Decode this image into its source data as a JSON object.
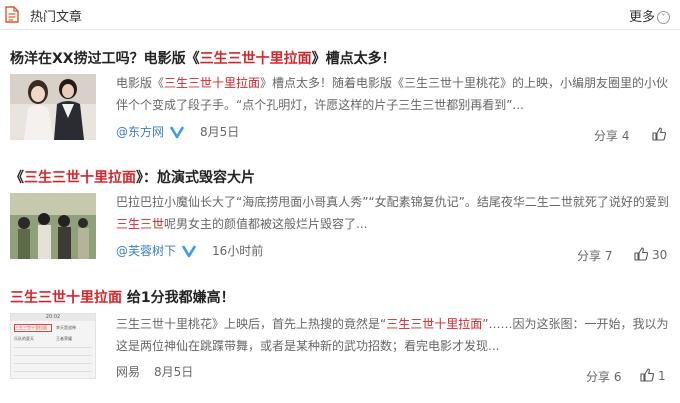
{
  "header": {
    "title": "热门文章",
    "more_label": "更多"
  },
  "articles": [
    {
      "title_parts": [
        "杨洋在XX捞过工吗？电影版《",
        "三生三世十里拉面",
        "》槽点太多！"
      ],
      "snippet_parts": [
        "电影版《",
        "三生三世十里拉面",
        "》槽点太多！随着电影版《三生三世十里桃花》的上映，小编朋友圈里的小伙伴个个变成了段子手。“点个孔明灯，许愿这样的片子三生三世都别再看到”..."
      ],
      "source_prefix": "@",
      "source": "东方网",
      "verified": true,
      "date": "8月5日",
      "share": "分享 4",
      "likes": ""
    },
    {
      "title_parts": [
        "《",
        "三生三世十里拉面",
        "》：尬演式毁容大片"
      ],
      "snippet_parts": [
        "巴拉巴拉小魔仙长大了“海底捞甩面小哥真人秀”“女配素锦复仇记”。结尾夜华二生二世就死了说好的爱到",
        "三生三世",
        "呢男女主的颜值都被这般烂片毁容了..."
      ],
      "source_prefix": "@",
      "source": "芙蓉树下",
      "verified": true,
      "date": "16小时前",
      "share": "分享 7",
      "likes": "30"
    },
    {
      "title_parts": [
        "",
        "三生三世十里拉面",
        " 给1分我都嫌高！"
      ],
      "snippet_parts": [
        "三生三世十里桃花》上映后，首先上热搜的竟然是“",
        "三生三世十里拉面",
        "”……因为这张图：一开始，我以为这是两位神仙在跳蹀带舞，或者是某种新的武功招数；看完电影才发现..."
      ],
      "source_prefix": "",
      "source": "网易",
      "verified": false,
      "date": "8月5日",
      "share": "分享 6",
      "likes": "1"
    }
  ],
  "thumb3_text": [
    "20:02",
    "三生三世十里拉面",
    "李天是战神",
    "乐队的夏天",
    "王者荣耀"
  ],
  "colors": {
    "accent_red": "#d4252b",
    "link_blue": "#3d7ec0",
    "text_gray": "#666666"
  },
  "icons": {
    "header": "document-icon",
    "verified": "weibo-verified-icon",
    "like": "thumbs-up-icon",
    "more": "chevron-down-icon"
  }
}
